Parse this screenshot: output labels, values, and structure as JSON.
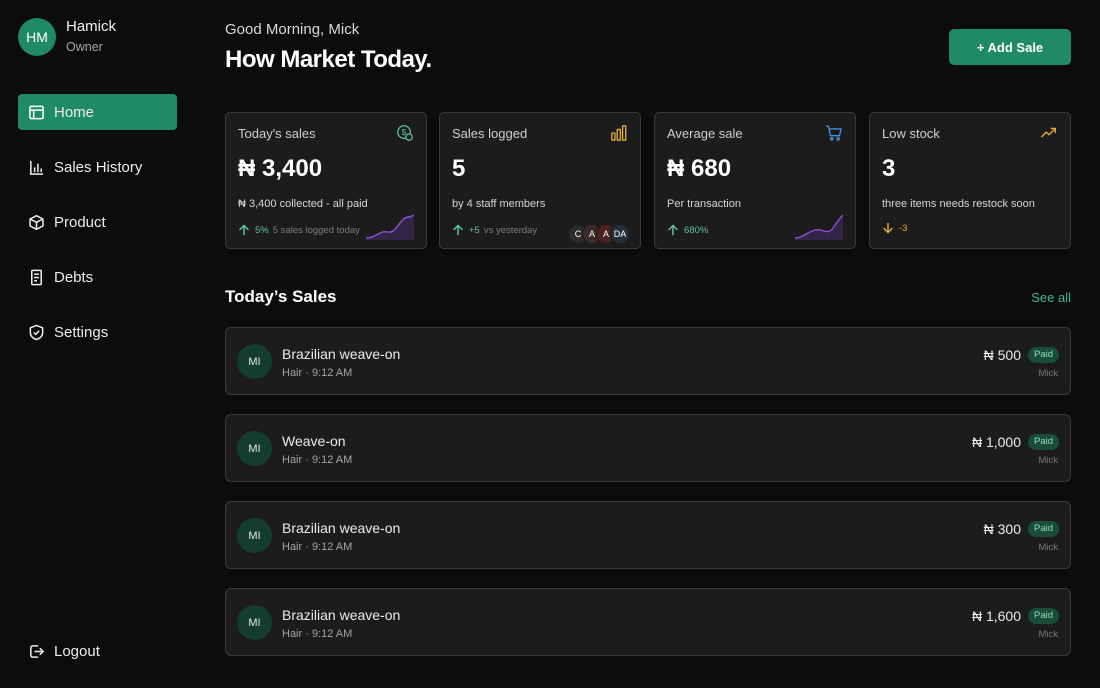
{
  "profile": {
    "initials": "HM",
    "name": "Hamick",
    "role": "Owner"
  },
  "nav": {
    "items": [
      {
        "label": "Home",
        "icon": "home-icon",
        "active": true
      },
      {
        "label": "Sales History",
        "icon": "bar-chart-icon"
      },
      {
        "label": "Product",
        "icon": "box-icon"
      },
      {
        "label": "Debts",
        "icon": "receipt-icon"
      },
      {
        "label": "Settings",
        "icon": "shield-icon"
      }
    ],
    "logout": "Logout"
  },
  "header": {
    "greeting": "Good Morning, Mick",
    "headline": "How Market Today.",
    "add_button": "+ Add Sale"
  },
  "stats": [
    {
      "title": "Today's sales",
      "value": "₦ 3,400",
      "sub": "₦ 3,400 collected - all paid",
      "pct": "5%",
      "note": "5 sales logged today",
      "icon": "money-icon",
      "accent": "#5ec49b"
    },
    {
      "title": "Sales logged",
      "value": "5",
      "sub": "by 4 staff members",
      "pct": "+5",
      "note": "vs yesterday",
      "icon": "bar-chart-icon",
      "accent": "#e0b030",
      "staff": [
        "C",
        "A",
        "A",
        "DA"
      ]
    },
    {
      "title": "Average sale",
      "value": "₦ 680",
      "sub": "Per transaction",
      "pct": "680%",
      "note": "",
      "icon": "cart-icon",
      "accent": "#4a90e2"
    },
    {
      "title": "Low stock",
      "value": "3",
      "sub": "three items needs restock soon",
      "pct": "-3",
      "note": "",
      "icon": "trend-down-icon",
      "accent": "#e0a53a"
    }
  ],
  "sales_section": {
    "title": "Today’s Sales",
    "see_all": "See all"
  },
  "sales": [
    {
      "initials": "MI",
      "name": "Brazilian weave-on",
      "meta": "Hair · 9:12 AM",
      "amount": "₦ 500",
      "status": "Paid",
      "by": "Mick"
    },
    {
      "initials": "MI",
      "name": "Weave-on",
      "meta": "Hair · 9:12 AM",
      "amount": "₦ 1,000",
      "status": "Paid",
      "by": "Mick"
    },
    {
      "initials": "MI",
      "name": "Brazilian weave-on",
      "meta": "Hair · 9:12 AM",
      "amount": "₦ 300",
      "status": "Paid",
      "by": "Mick"
    },
    {
      "initials": "MI",
      "name": "Brazilian weave-on",
      "meta": "Hair · 9:12 AM",
      "amount": "₦ 1,600",
      "status": "Paid",
      "by": "Mick"
    }
  ],
  "colors": {
    "brand": "#1f8a64",
    "background": "#0c0c0c",
    "card": "#1c1c1c"
  }
}
